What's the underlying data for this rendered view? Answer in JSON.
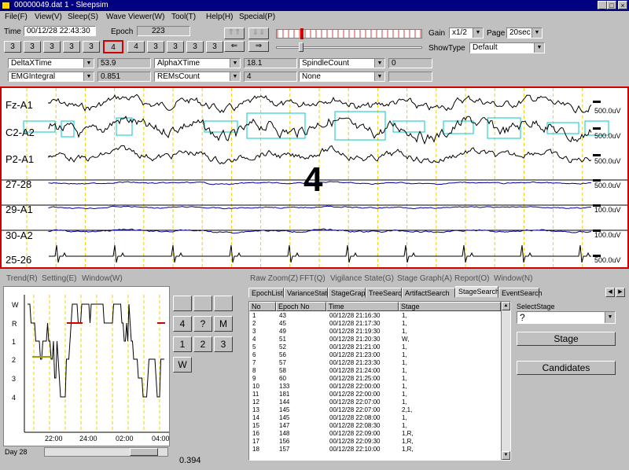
{
  "window": {
    "title": "00000049.dat 1 - Sleepsim",
    "minimize": "_",
    "maximize": "□",
    "close": "×"
  },
  "menu": [
    "File(F)",
    "View(V)",
    "Sleep(S)",
    "Wave Viewer(W)",
    "Tool(T)",
    "Help(H)",
    "Special(P)"
  ],
  "toolbar": {
    "time_label": "Time",
    "time_value": "00/12/28 22:43:30",
    "epoch_label": "Epoch",
    "epoch_value": "223",
    "stage_buttons_left": [
      "3",
      "3",
      "3",
      "3",
      "3"
    ],
    "current_stage": "4",
    "stage_buttons_right": [
      "4",
      "3",
      "3",
      "3",
      "3"
    ],
    "nav_up": "⇑⇑",
    "nav_up2": "⇓⇓",
    "nav_left": "⇐",
    "nav_right": "⇒",
    "gain_label": "Gain",
    "gain_value": "x1/2",
    "page_label": "Page",
    "page_value": "20sec",
    "showtype_label": "ShowType",
    "showtype_value": "Default"
  },
  "params": [
    {
      "name": "DeltaXTime",
      "value": "53.9"
    },
    {
      "name": "AlphaXTime",
      "value": "18.1"
    },
    {
      "name": "SpindleCount",
      "value": "0"
    },
    {
      "name": "EMGIntegral",
      "value": "0.851"
    },
    {
      "name": "REMsCount",
      "value": "4"
    },
    {
      "name": "None",
      "value": ""
    }
  ],
  "waveform": {
    "stage_overlay": "4",
    "channels": [
      {
        "label": "Fz-A1",
        "scale": "500.0uV"
      },
      {
        "label": "C2-A2",
        "scale": "500.0uV"
      },
      {
        "label": "P2-A1",
        "scale": "500.0uV"
      },
      {
        "label": "27-28",
        "scale": "500.0uV"
      },
      {
        "label": "29-A1",
        "scale": "100.0uV"
      },
      {
        "label": "30-A2",
        "scale": "100.0uV"
      },
      {
        "label": "25-26",
        "scale": "500.0uV"
      }
    ]
  },
  "left_menu": [
    "Trend(R)",
    "Setting(E)",
    "Window(W)"
  ],
  "right_menu": [
    "Raw Zoom(Z)",
    "FFT(Q)",
    "Vigilance State(G)",
    "Stage Graph(A)",
    "Report(O)",
    "Window(N)"
  ],
  "trend": {
    "y_labels": [
      "W",
      "R",
      "1",
      "2",
      "3",
      "4"
    ],
    "x_labels": [
      "22:00",
      "24:00",
      "02:00",
      "04:00"
    ],
    "day": "Day 28",
    "value": "0.394"
  },
  "keypad": [
    "",
    "",
    "",
    "4",
    "?",
    "M",
    "1",
    "2",
    "3",
    "W"
  ],
  "tabs": [
    "EpochList",
    "VarianceState",
    "StageGraph",
    "TreeSearch",
    "ArtifactSearch",
    "StageSearch",
    "EventSearch"
  ],
  "list": {
    "headers": [
      "No",
      "Epoch No",
      "Time",
      "Stage"
    ],
    "rows": [
      [
        "1",
        "43",
        "00/12/28 21:16:30",
        "1,"
      ],
      [
        "2",
        "45",
        "00/12/28 21:17:30",
        "1,"
      ],
      [
        "3",
        "49",
        "00/12/28 21:19:30",
        "1,"
      ],
      [
        "4",
        "51",
        "00/12/28 21:20:30",
        "W,"
      ],
      [
        "5",
        "52",
        "00/12/28 21:21:00",
        "1,"
      ],
      [
        "6",
        "56",
        "00/12/28 21:23:00",
        "1,"
      ],
      [
        "7",
        "57",
        "00/12/28 21:23:30",
        "1,"
      ],
      [
        "8",
        "58",
        "00/12/28 21:24:00",
        "1,"
      ],
      [
        "9",
        "60",
        "00/12/28 21:25:00",
        "1,"
      ],
      [
        "10",
        "133",
        "00/12/28 22:00:00",
        "1,"
      ],
      [
        "11",
        "181",
        "00/12/28 22:00:00",
        "1,"
      ],
      [
        "12",
        "144",
        "00/12/28 22:07:00",
        "1,"
      ],
      [
        "13",
        "145",
        "00/12/28 22:07:00",
        "2,1,"
      ],
      [
        "14",
        "145",
        "00/12/28 22:08:00",
        "1,"
      ],
      [
        "15",
        "147",
        "00/12/28 22:08:30",
        "1,"
      ],
      [
        "16",
        "148",
        "00/12/28 22:09:00",
        "1,R,"
      ],
      [
        "17",
        "156",
        "00/12/28 22:09:30",
        "1,R,"
      ],
      [
        "18",
        "157",
        "00/12/28 22:10:00",
        "1,R,"
      ]
    ]
  },
  "stage_panel": {
    "select_label": "SelectStage",
    "select_value": "?",
    "stage_button": "Stage",
    "candidates_button": "Candidates"
  }
}
